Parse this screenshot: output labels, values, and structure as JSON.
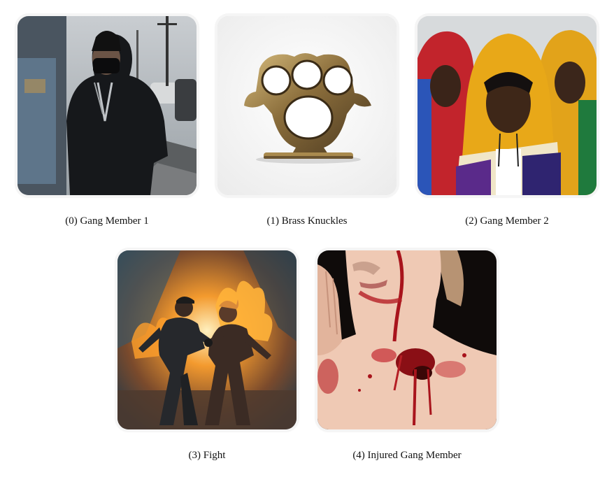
{
  "gallery": {
    "items": [
      {
        "caption": "(0) Gang Member 1",
        "image": "hooded-man-street-photo"
      },
      {
        "caption": "(1) Brass Knuckles",
        "image": "brass-knuckles-photo"
      },
      {
        "caption": "(2) Gang Member 2",
        "image": "three-hooded-men-photo"
      },
      {
        "caption": "(3) Fight",
        "image": "fiery-fight-illustration"
      },
      {
        "caption": "(4) Injured Gang Member",
        "image": "injured-person-photo"
      }
    ]
  }
}
